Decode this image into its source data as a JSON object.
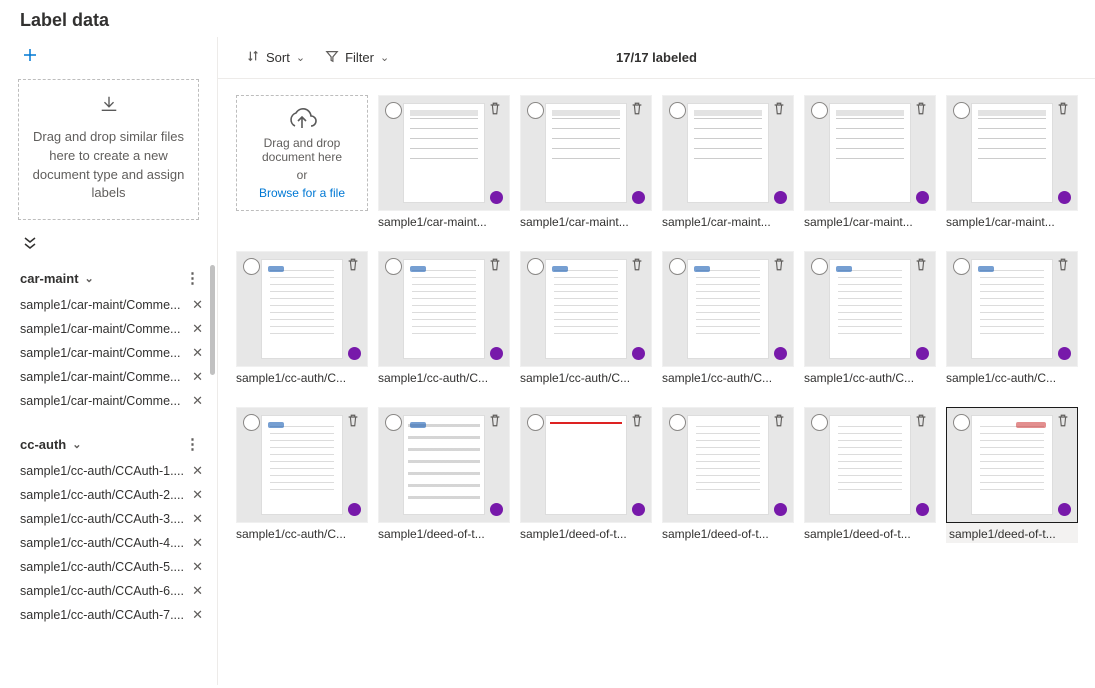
{
  "page": {
    "title": "Label data"
  },
  "sidebar": {
    "dropzone_text": "Drag and drop similar files here to create a new document type and assign labels",
    "groups": [
      {
        "name": "car-maint",
        "files": [
          "sample1/car-maint/Comme...",
          "sample1/car-maint/Comme...",
          "sample1/car-maint/Comme...",
          "sample1/car-maint/Comme...",
          "sample1/car-maint/Comme..."
        ]
      },
      {
        "name": "cc-auth",
        "files": [
          "sample1/cc-auth/CCAuth-1....",
          "sample1/cc-auth/CCAuth-2....",
          "sample1/cc-auth/CCAuth-3....",
          "sample1/cc-auth/CCAuth-4....",
          "sample1/cc-auth/CCAuth-5....",
          "sample1/cc-auth/CCAuth-6....",
          "sample1/cc-auth/CCAuth-7...."
        ]
      }
    ]
  },
  "toolbar": {
    "sort_label": "Sort",
    "filter_label": "Filter",
    "labeled_count": "17/17 labeled"
  },
  "upload": {
    "line1": "Drag and drop document here",
    "line2": "or",
    "browse": "Browse for a file"
  },
  "docs": [
    {
      "label": "sample1/car-maint...",
      "variant": "grid",
      "dot": true,
      "selected": false
    },
    {
      "label": "sample1/car-maint...",
      "variant": "grid",
      "dot": true,
      "selected": false
    },
    {
      "label": "sample1/car-maint...",
      "variant": "grid",
      "dot": true,
      "selected": false
    },
    {
      "label": "sample1/car-maint...",
      "variant": "grid",
      "dot": true,
      "selected": false
    },
    {
      "label": "sample1/car-maint...",
      "variant": "grid",
      "dot": true,
      "selected": false
    },
    {
      "label": "sample1/cc-auth/C...",
      "variant": "logo-lines",
      "dot": true,
      "selected": false
    },
    {
      "label": "sample1/cc-auth/C...",
      "variant": "logo-lines",
      "dot": true,
      "selected": false
    },
    {
      "label": "sample1/cc-auth/C...",
      "variant": "logo-lines",
      "dot": true,
      "selected": false
    },
    {
      "label": "sample1/cc-auth/C...",
      "variant": "logo-lines",
      "dot": true,
      "selected": false
    },
    {
      "label": "sample1/cc-auth/C...",
      "variant": "logo-lines",
      "dot": true,
      "selected": false
    },
    {
      "label": "sample1/cc-auth/C...",
      "variant": "logo-lines",
      "dot": true,
      "selected": false
    },
    {
      "label": "sample1/cc-auth/C...",
      "variant": "logo-lines",
      "dot": true,
      "selected": false
    },
    {
      "label": "sample1/deed-of-t...",
      "variant": "bars",
      "dot": true,
      "selected": false
    },
    {
      "label": "sample1/deed-of-t...",
      "variant": "red-lines",
      "dot": true,
      "selected": false
    },
    {
      "label": "sample1/deed-of-t...",
      "variant": "lines",
      "dot": true,
      "selected": false
    },
    {
      "label": "sample1/deed-of-t...",
      "variant": "lines",
      "dot": true,
      "selected": false
    },
    {
      "label": "sample1/deed-of-t...",
      "variant": "right-logo",
      "dot": true,
      "selected": true
    }
  ],
  "colors": {
    "accent": "#0078d4",
    "status_dot": "#7719aa"
  }
}
